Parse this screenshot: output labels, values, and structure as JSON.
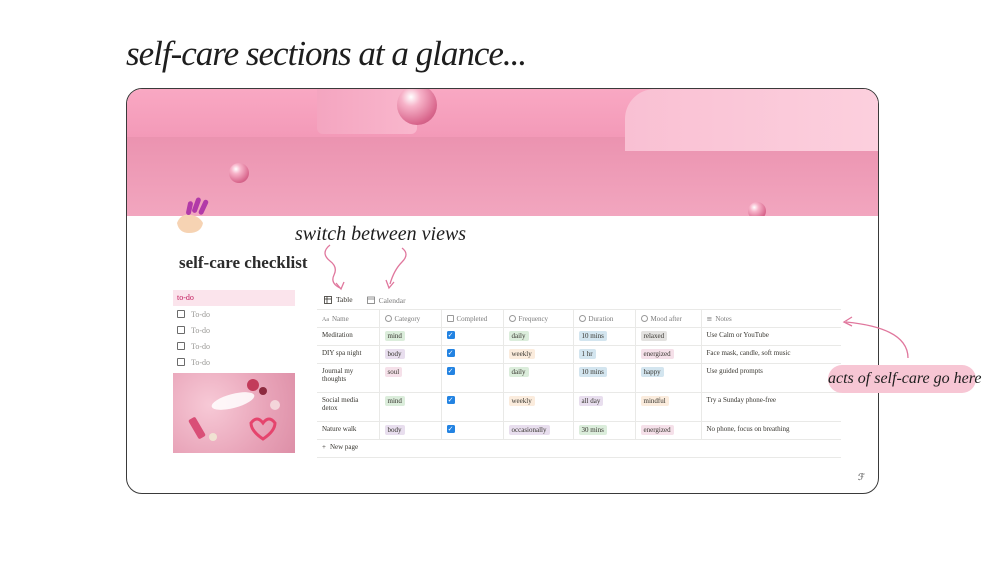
{
  "headline": "self-care sections at a glance...",
  "annotations": {
    "views": "switch between views",
    "acts": "acts of self-care go here"
  },
  "page": {
    "title": "self-care checklist",
    "todo_header": "to-do",
    "todo_items": [
      "To-do",
      "To-do",
      "To-do",
      "To-do"
    ]
  },
  "tabs": [
    {
      "label": "Table",
      "icon": "table-icon"
    },
    {
      "label": "Calendar",
      "icon": "calendar-icon"
    }
  ],
  "columns": [
    "Name",
    "Category",
    "Completed",
    "Frequency",
    "Duration",
    "Mood after",
    "Notes"
  ],
  "rows": [
    {
      "name": "Meditation",
      "category": "mind",
      "completed": true,
      "frequency": "daily",
      "duration": "10 mins",
      "mood": "relaxed",
      "notes": "Use Calm or YouTube"
    },
    {
      "name": "DIY spa night",
      "category": "body",
      "completed": true,
      "frequency": "weekly",
      "duration": "1 hr",
      "mood": "energized",
      "notes": "Face mask, candle, soft music"
    },
    {
      "name": "Journal my thoughts",
      "category": "soul",
      "completed": true,
      "frequency": "daily",
      "duration": "10 mins",
      "mood": "happy",
      "notes": "Use guided prompts"
    },
    {
      "name": "Social media detox",
      "category": "mind",
      "completed": true,
      "frequency": "weekly",
      "duration": "all day",
      "mood": "mindful",
      "notes": "Try a Sunday phone-free"
    },
    {
      "name": "Nature walk",
      "category": "body",
      "completed": true,
      "frequency": "occasionally",
      "duration": "30 mins",
      "mood": "energized",
      "notes": "No phone, focus on breathing"
    }
  ],
  "new_page": "New page",
  "colors": {
    "mind": "#dbeddb",
    "body": "#e8deee",
    "soul": "#f5e0e9",
    "daily": "#dbeddb",
    "weekly": "#fbecdd",
    "occasionally": "#e8deee",
    "duration": "#d3e5ef",
    "all day": "#e8deee",
    "30 mins": "#dbeddb",
    "relaxed": "#e3e2e0",
    "energized": "#f5e0e9",
    "happy": "#d3e5ef",
    "mindful": "#fbecdd"
  }
}
